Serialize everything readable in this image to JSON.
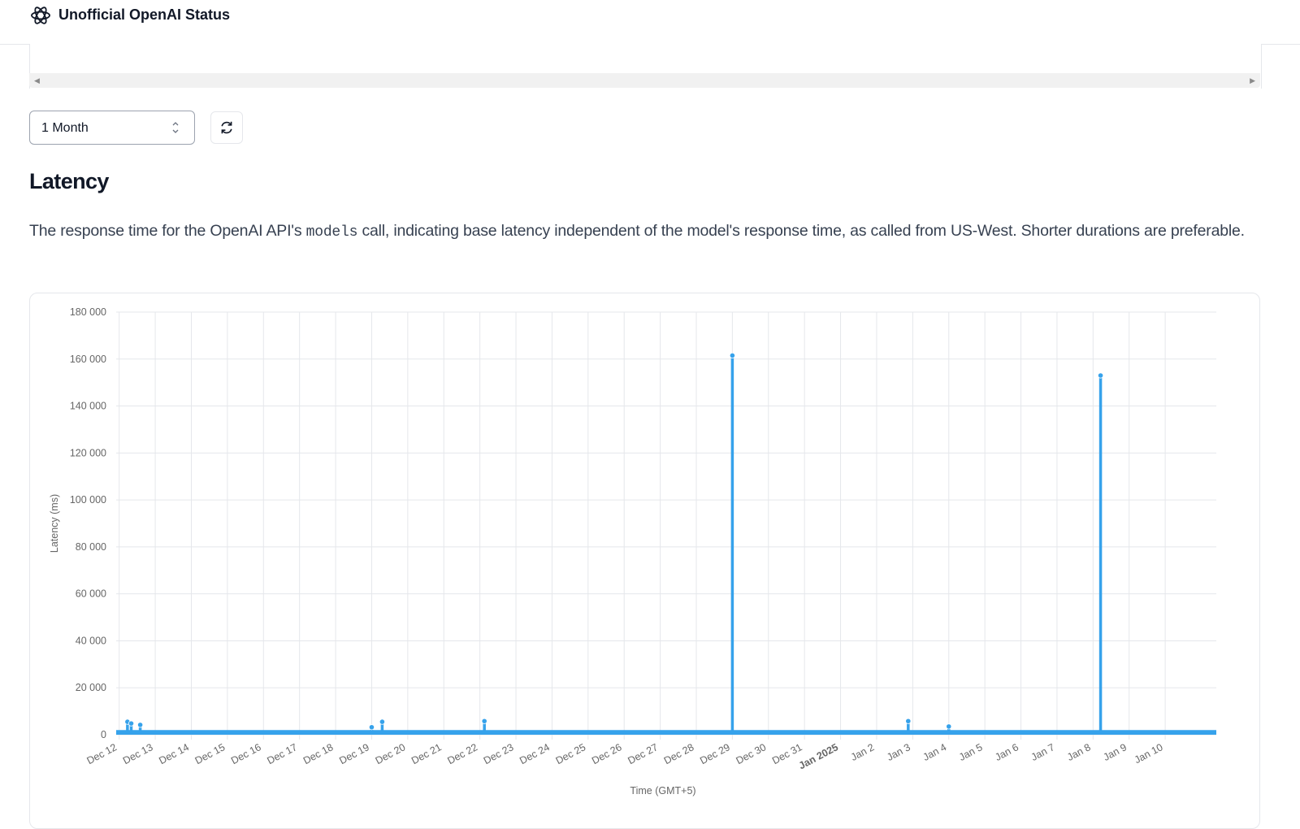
{
  "header": {
    "title": "Unofficial OpenAI Status",
    "logo_icon": "openai-logo-icon"
  },
  "controls": {
    "range_value": "1 Month",
    "range_icon": "chevron-up-down-icon",
    "refresh_icon": "refresh-icon"
  },
  "section": {
    "title": "Latency",
    "description_before": "The response time for the OpenAI API's ",
    "description_code": "models",
    "description_after": " call, indicating base latency independent of the model's response time, as called from US-West. Shorter durations are preferable."
  },
  "colors": {
    "series": "#36a2eb",
    "grid": "#e5e7eb",
    "text": "#666666"
  },
  "chart_data": {
    "type": "area",
    "title": "",
    "xlabel": "Time (GMT+5)",
    "ylabel": "Latency (ms)",
    "ylim": [
      0,
      180000
    ],
    "y_ticks": [
      "0",
      "20 000",
      "40 000",
      "60 000",
      "80 000",
      "100 000",
      "120 000",
      "140 000",
      "160 000",
      "180 000"
    ],
    "x_ticks": [
      "Dec 12",
      "Dec 13",
      "Dec 14",
      "Dec 15",
      "Dec 16",
      "Dec 17",
      "Dec 18",
      "Dec 19",
      "Dec 20",
      "Dec 21",
      "Dec 22",
      "Dec 23",
      "Dec 24",
      "Dec 25",
      "Dec 26",
      "Dec 27",
      "Dec 28",
      "Dec 29",
      "Dec 30",
      "Dec 31",
      "Jan 2025",
      "Jan 2",
      "Jan 3",
      "Jan 4",
      "Jan 5",
      "Jan 6",
      "Jan 7",
      "Jan 8",
      "Jan 9",
      "Jan 10"
    ],
    "x_tick_bold": [
      "Jan 2025"
    ],
    "x_range": [
      "2024-12-11T17:00",
      "2025-01-11T05:00"
    ],
    "baseline_ms": 800,
    "grid": true,
    "legend": "none",
    "series": [
      {
        "points": [
          {
            "x": "2024-12-12T00:30",
            "y": 5500
          },
          {
            "x": "2024-12-12T03:00",
            "y": 4800
          },
          {
            "x": "2024-12-12T09:00",
            "y": 4200
          },
          {
            "x": "2024-12-18T19:00",
            "y": 3200
          },
          {
            "x": "2024-12-19T02:00",
            "y": 5500
          },
          {
            "x": "2024-12-21T22:00",
            "y": 5800
          },
          {
            "x": "2024-12-28T19:00",
            "y": 161500
          },
          {
            "x": "2025-01-02T16:00",
            "y": 5800
          },
          {
            "x": "2025-01-03T19:00",
            "y": 3500
          },
          {
            "x": "2025-01-08T00:00",
            "y": 153000
          }
        ]
      }
    ]
  }
}
